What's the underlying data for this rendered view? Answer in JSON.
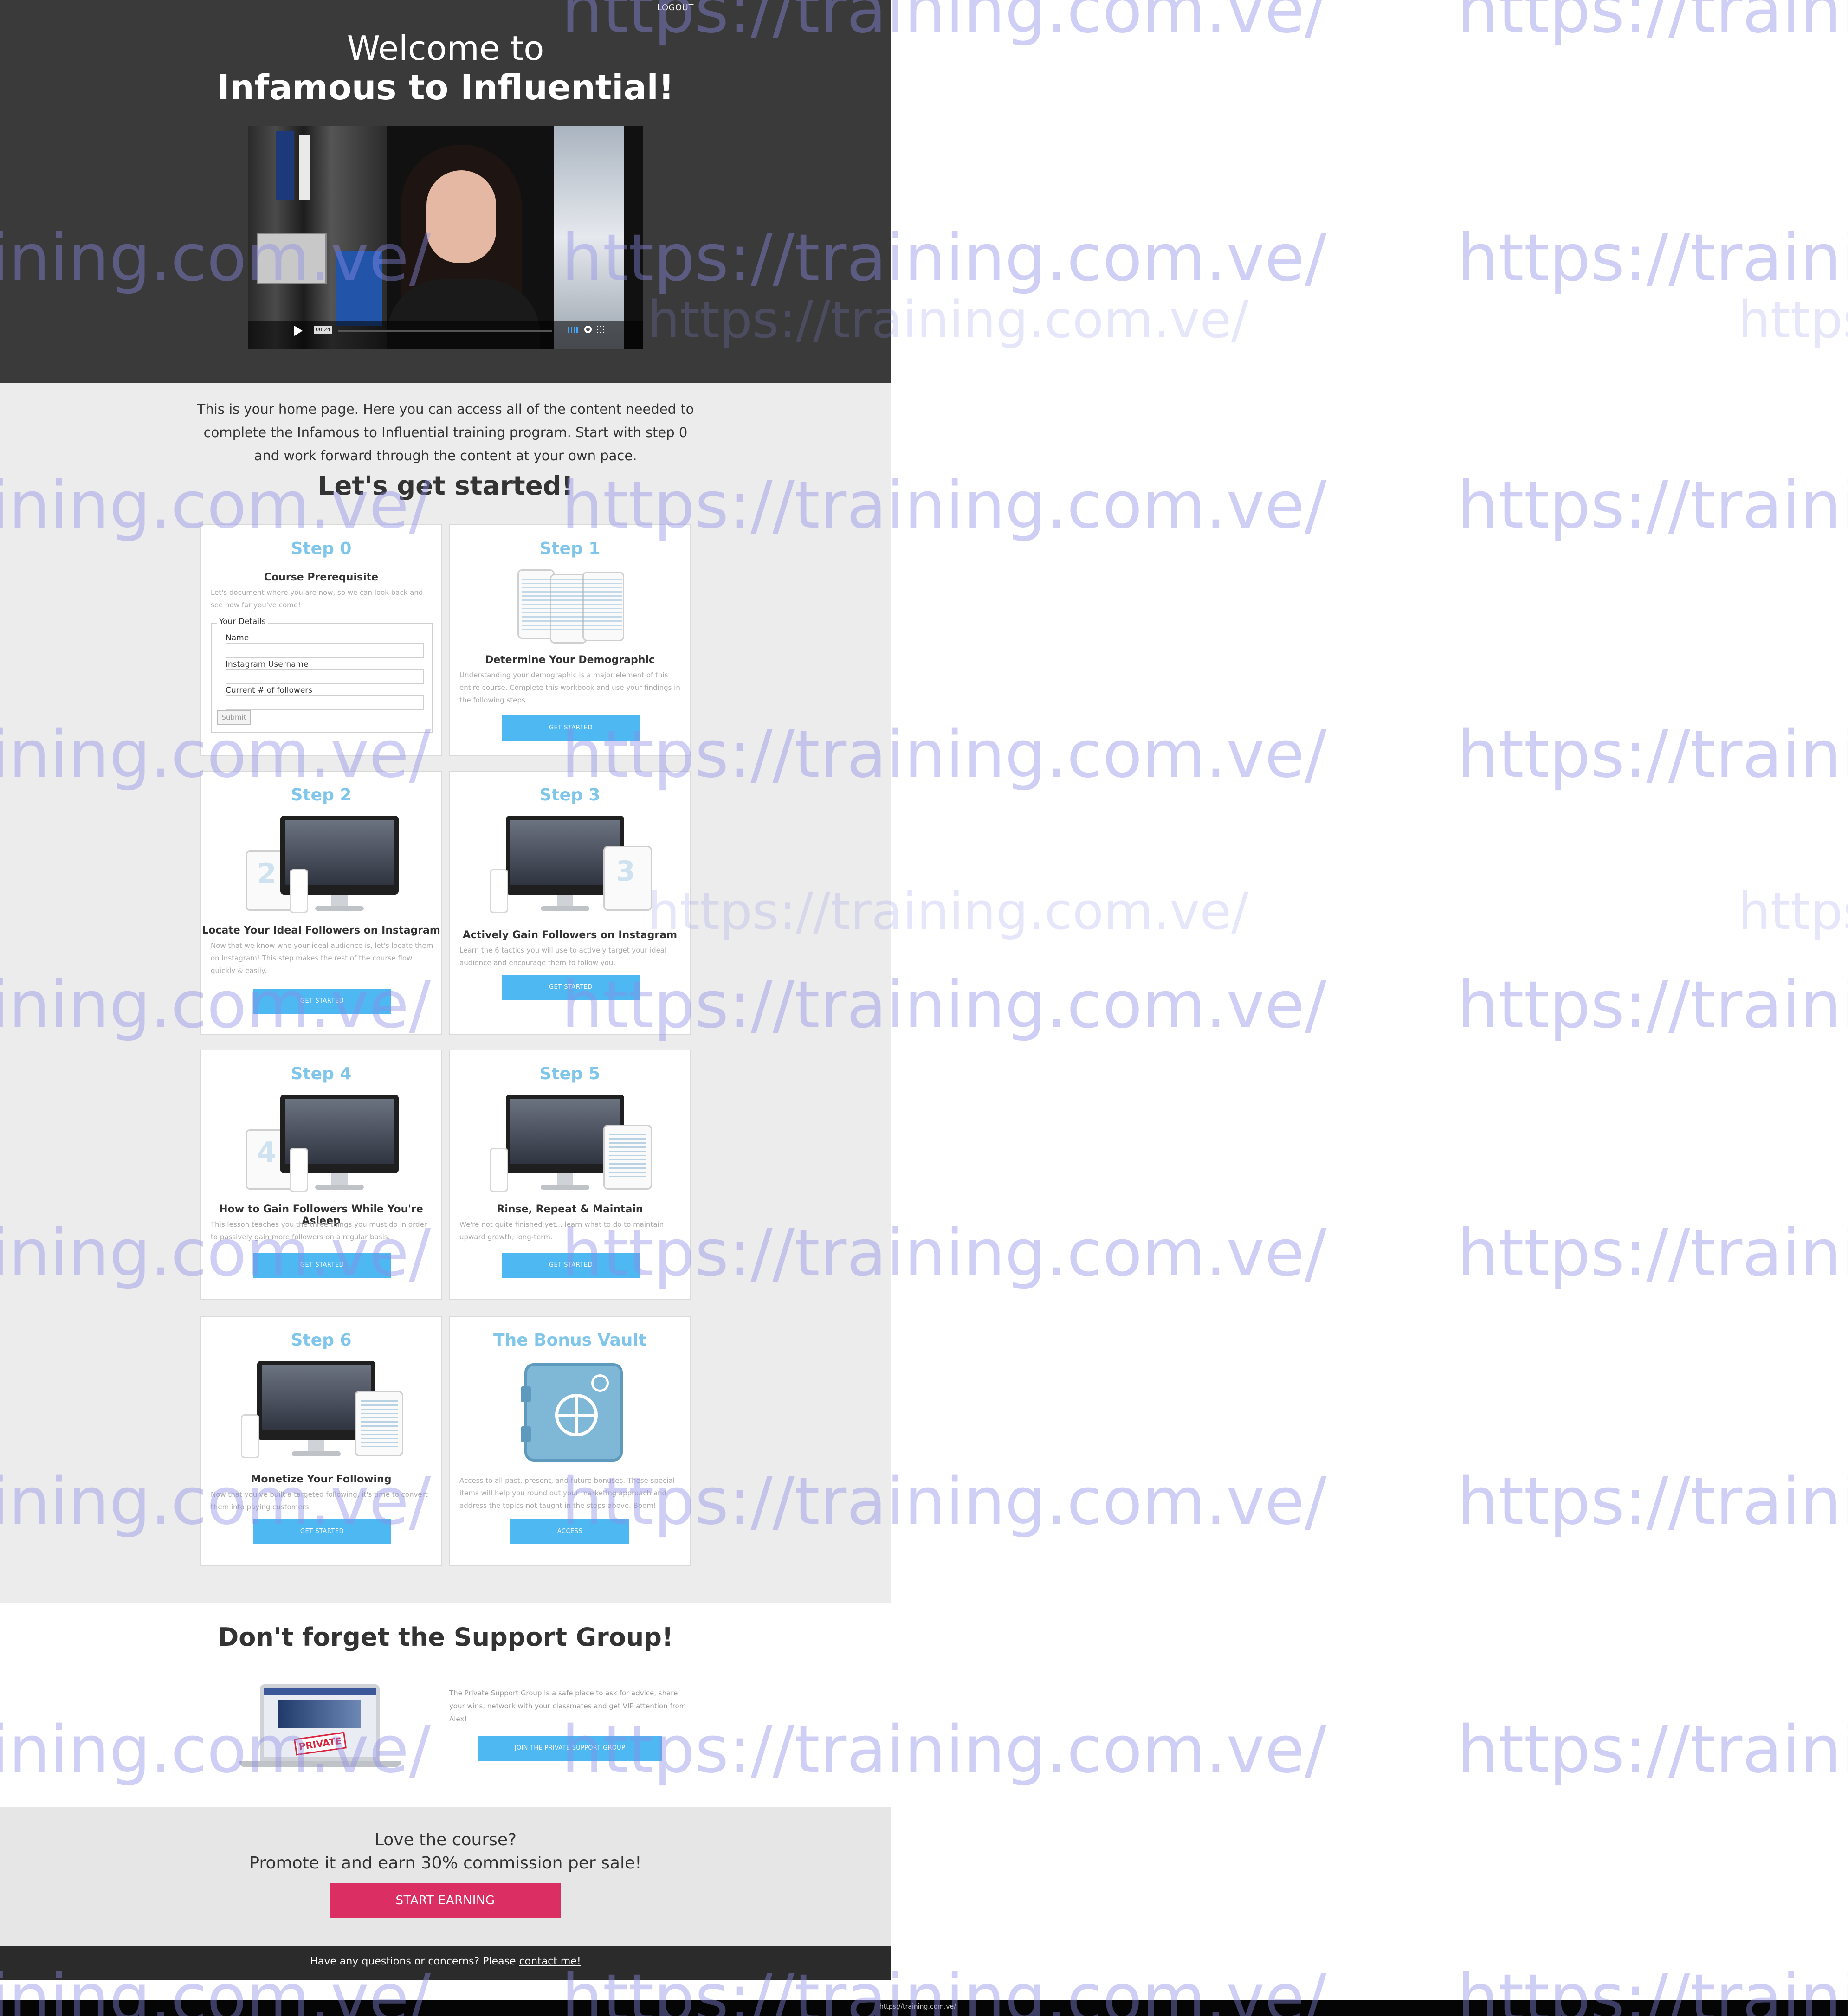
{
  "header": {
    "logout_label": "LOGOUT",
    "welcome_line1": "Welcome to",
    "welcome_line2": "Infamous to Influential!"
  },
  "video": {
    "badge": "00:24",
    "icons": [
      "play-icon",
      "volume-icon",
      "settings-icon",
      "fullscreen-icon"
    ]
  },
  "intro": {
    "text": "This is your home page. Here you can access all of the content needed to complete the Infamous to Influential training program. Start with step 0 and work forward through the content at your own pace.",
    "heading": "Let's get started!"
  },
  "steps": {
    "step0": {
      "label": "Step 0",
      "title": "Course Prerequisite",
      "desc": "Let's document where you are now, so we can look back and see how far you've come!",
      "form": {
        "legend": "Your Details",
        "name_label": "Name",
        "instagram_label": "Instagram Username",
        "followers_label": "Current # of followers",
        "submit_label": "Submit"
      }
    },
    "step1": {
      "label": "Step 1",
      "title": "Determine Your Demographic",
      "desc": "Understanding your demographic is a major element of this entire course. Complete this workbook and use your findings in the following steps.",
      "button": "GET STARTED"
    },
    "step2": {
      "label": "Step 2",
      "title": "Locate Your Ideal Followers on Instagram",
      "desc": "Now that we know who your ideal audience is, let's locate them on Instagram! This step makes the rest of the course flow quickly & easily.",
      "button": "GET STARTED"
    },
    "step3": {
      "label": "Step 3",
      "title": "Actively Gain Followers on Instagram",
      "desc": "Learn the 6 tactics you will use to actively target your ideal audience and encourage them to follow you.",
      "button": "GET STARTED"
    },
    "step4": {
      "label": "Step 4",
      "title": "How to Gain Followers While You're Asleep",
      "desc": "This lesson teaches you the three things you must do in order to passively gain more followers on a regular basis.",
      "button": "GET STARTED"
    },
    "step5": {
      "label": "Step 5",
      "title": "Rinse, Repeat & Maintain",
      "desc": "We're not quite finished yet... learn what to do to maintain upward growth, long-term.",
      "button": "GET STARTED"
    },
    "step6": {
      "label": "Step 6",
      "title": "Monetize Your Following",
      "desc": "Now that you've built a targeted following, it's time to convert them into paying customers.",
      "button": "GET STARTED"
    },
    "bonus": {
      "label": "The Bonus Vault",
      "desc": "Access to all past, present, and future bonuses. These special items will help you round out your marketing approach and address the topics not taught in the steps above. Boom!",
      "button": "ACCESS"
    }
  },
  "support": {
    "title": "Don't forget the Support Group!",
    "stamp": "PRIVATE",
    "text": "The Private Support Group is a safe place to ask for advice, share your wins, network with your classmates and get VIP attention from Alex!",
    "button": "JOIN THE PRIVATE SUPPORT GROUP"
  },
  "promote": {
    "line1": "Love the course?",
    "line2": "Promote it and earn 30% commission per sale!",
    "button": "START EARNING"
  },
  "footer": {
    "text": "Have any questions or concerns? Please ",
    "link": "contact me!"
  },
  "bottom_bar": {
    "url": "https://training.com.ve/"
  },
  "watermark": {
    "text": "https://training.com.ve/"
  },
  "colors": {
    "hero_bg": "#3a3a3a",
    "step_title": "#7fc6ea",
    "button_blue": "#4db8f2",
    "cta_pink": "#db2e63",
    "footer_bg": "#2b2b2b",
    "watermark": "#8c8ce6"
  }
}
